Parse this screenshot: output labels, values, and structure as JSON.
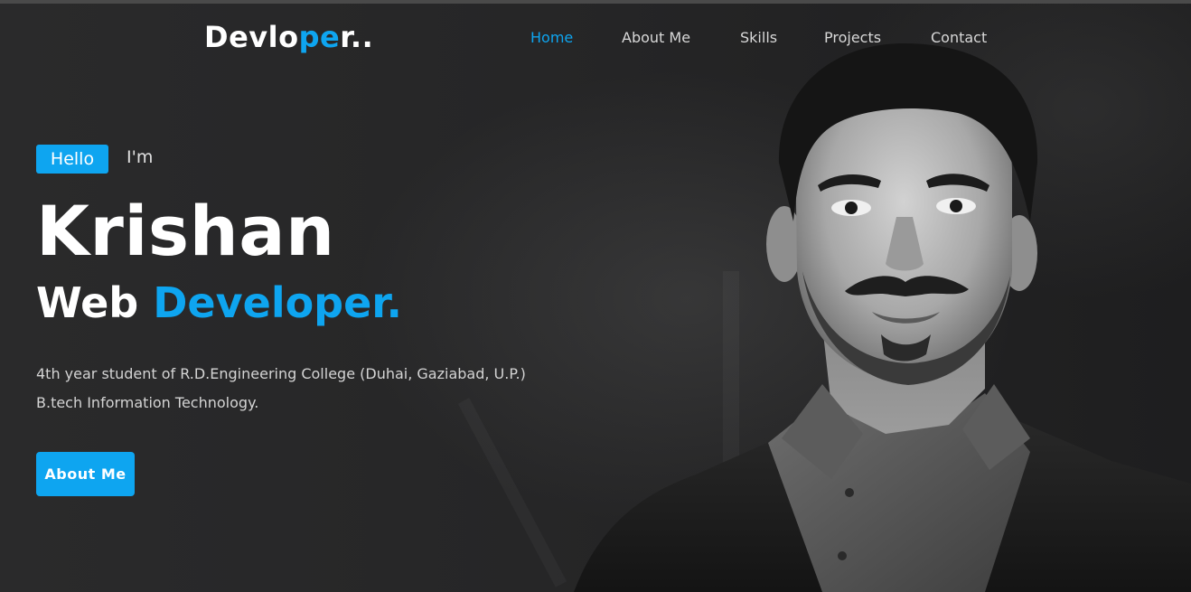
{
  "logo": {
    "part1": "Devlo",
    "part2": "pe",
    "part3": "r.."
  },
  "nav": {
    "items": [
      {
        "label": "Home",
        "active": true
      },
      {
        "label": "About Me",
        "active": false
      },
      {
        "label": "Skills",
        "active": false
      },
      {
        "label": "Projects",
        "active": false
      },
      {
        "label": "Contact",
        "active": false
      }
    ]
  },
  "hero": {
    "badge": "Hello",
    "intro": "I'm",
    "name": "Krishan",
    "role_prefix": "Web",
    "role_highlight": "Developer.",
    "description_line1": "4th year student of R.D.Engineering College (Duhai, Gaziabad, U.P.)",
    "description_line2": "B.tech Information Technology.",
    "button_label": "About Me"
  },
  "colors": {
    "accent": "#0ea5f0",
    "background": "#262627",
    "text": "#ffffff"
  }
}
